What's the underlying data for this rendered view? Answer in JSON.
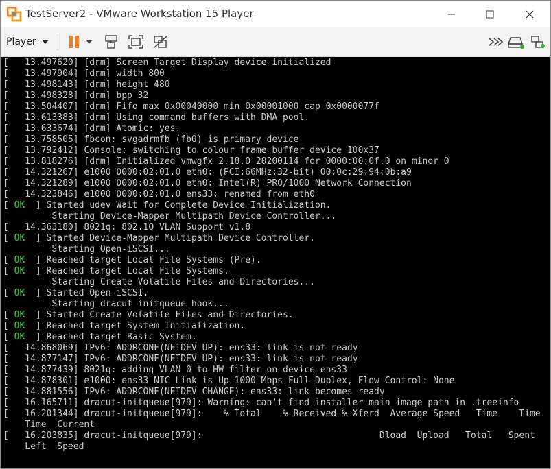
{
  "window": {
    "title": "TestServer2 - VMware Workstation 15 Player",
    "controls": {
      "minimize": "–",
      "maximize": "☐",
      "close": "✕"
    }
  },
  "toolbar": {
    "player_label": "Player",
    "icons": [
      "pause-icon",
      "send-ctrl-alt-del-icon",
      "fullscreen-icon",
      "unity-icon",
      "forward-icon",
      "removable-devices-icon",
      "network-adapter-icon"
    ],
    "accent_color": "#f08020"
  },
  "console": {
    "lines": [
      {
        "prefix": "[ ",
        "status": "",
        "text": "  13.497620] [drm] Screen Target Display device initialized"
      },
      {
        "prefix": "[ ",
        "status": "",
        "text": "  13.497904] [drm] width 800"
      },
      {
        "prefix": "[ ",
        "status": "",
        "text": "  13.498143] [drm] height 480"
      },
      {
        "prefix": "[ ",
        "status": "",
        "text": "  13.498328] [drm] bpp 32"
      },
      {
        "prefix": "[ ",
        "status": "",
        "text": "  13.504407] [drm] Fifo max 0x00040000 min 0x00001000 cap 0x0000077f"
      },
      {
        "prefix": "[ ",
        "status": "",
        "text": "  13.613383] [drm] Using command buffers with DMA pool."
      },
      {
        "prefix": "[ ",
        "status": "",
        "text": "  13.633674] [drm] Atomic: yes."
      },
      {
        "prefix": "[ ",
        "status": "",
        "text": "  13.758505] fbcon: svgadrmfb (fb0) is primary device"
      },
      {
        "prefix": "[ ",
        "status": "",
        "text": "  13.792412] Console: switching to colour frame buffer device 100x37"
      },
      {
        "prefix": "[ ",
        "status": "",
        "text": "  13.818276] [drm] Initialized vmwgfx 2.18.0 20200114 for 0000:00:0f.0 on minor 0"
      },
      {
        "prefix": "[ ",
        "status": "",
        "text": "  14.321267] e1000 0000:02:01.0 eth0: (PCI:66MHz:32-bit) 00:0c:29:94:0b:a9"
      },
      {
        "prefix": "[ ",
        "status": "",
        "text": "  14.321289] e1000 0000:02:01.0 eth0: Intel(R) PRO/1000 Network Connection"
      },
      {
        "prefix": "[ ",
        "status": "",
        "text": "  14.323846] e1000 0000:02:01.0 ens33: renamed from eth0"
      },
      {
        "prefix": "[ ",
        "status": "OK",
        "text": "  ] Started udev Wait for Complete Device Initialization."
      },
      {
        "prefix": "",
        "status": "",
        "text": "         Starting Device-Mapper Multipath Device Controller..."
      },
      {
        "prefix": "[ ",
        "status": "",
        "text": "  14.363180] 8021q: 802.1Q VLAN Support v1.8"
      },
      {
        "prefix": "[ ",
        "status": "OK",
        "text": "  ] Started Device-Mapper Multipath Device Controller."
      },
      {
        "prefix": "",
        "status": "",
        "text": "         Starting Open-iSCSI..."
      },
      {
        "prefix": "[ ",
        "status": "OK",
        "text": "  ] Reached target Local File Systems (Pre)."
      },
      {
        "prefix": "[ ",
        "status": "OK",
        "text": "  ] Reached target Local File Systems."
      },
      {
        "prefix": "",
        "status": "",
        "text": "         Starting Create Volatile Files and Directories..."
      },
      {
        "prefix": "[ ",
        "status": "OK",
        "text": "  ] Started Open-iSCSI."
      },
      {
        "prefix": "",
        "status": "",
        "text": "         Starting dracut initqueue hook..."
      },
      {
        "prefix": "[ ",
        "status": "OK",
        "text": "  ] Started Create Volatile Files and Directories."
      },
      {
        "prefix": "[ ",
        "status": "OK",
        "text": "  ] Reached target System Initialization."
      },
      {
        "prefix": "[ ",
        "status": "OK",
        "text": "  ] Reached target Basic System."
      },
      {
        "prefix": "[ ",
        "status": "",
        "text": "  14.868069] IPv6: ADDRCONF(NETDEV_UP): ens33: link is not ready"
      },
      {
        "prefix": "[ ",
        "status": "",
        "text": "  14.877147] IPv6: ADDRCONF(NETDEV_UP): ens33: link is not ready"
      },
      {
        "prefix": "[ ",
        "status": "",
        "text": "  14.877439] 8021q: adding VLAN 0 to HW filter on device ens33"
      },
      {
        "prefix": "[ ",
        "status": "",
        "text": "  14.878301] e1000: ens33 NIC Link is Up 1000 Mbps Full Duplex, Flow Control: None"
      },
      {
        "prefix": "[ ",
        "status": "",
        "text": "  14.881556] IPv6: ADDRCONF(NETDEV_CHANGE): ens33: link becomes ready"
      },
      {
        "prefix": "[ ",
        "status": "",
        "text": "  16.165711] dracut-initqueue[979]: Warning: can't find installer main image path in .treeinfo"
      },
      {
        "prefix": "[ ",
        "status": "",
        "text": "  16.201344] dracut-initqueue[979]:    % Total    % Received % Xferd  Average Speed   Time    Time"
      },
      {
        "prefix": "",
        "status": "",
        "text": "    Time  Current"
      },
      {
        "prefix": "[ ",
        "status": "",
        "text": "  16.203835] dracut-initqueue[979]:                                 Dload  Upload   Total   Spent"
      },
      {
        "prefix": "",
        "status": "",
        "text": "    Left  Speed"
      }
    ]
  }
}
